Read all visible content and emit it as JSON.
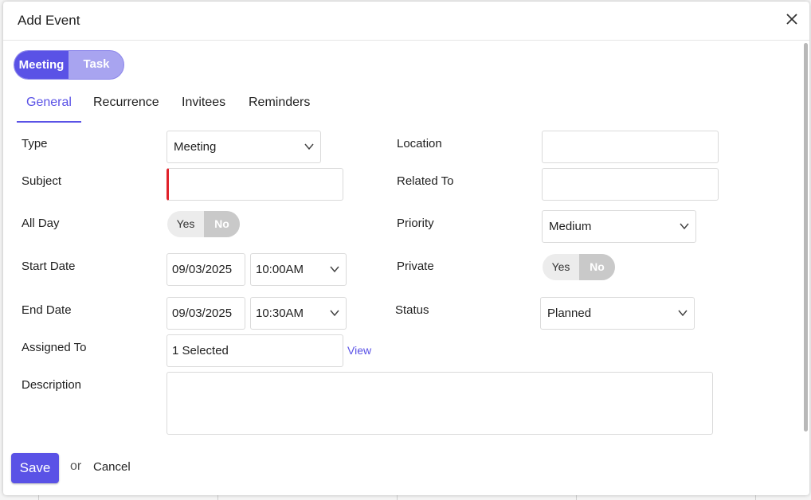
{
  "dialog": {
    "title": "Add Event"
  },
  "type_switch": {
    "active": "Meeting",
    "inactive": "Task"
  },
  "tabs": [
    {
      "label": "General"
    },
    {
      "label": "Recurrence"
    },
    {
      "label": "Invitees"
    },
    {
      "label": "Reminders"
    }
  ],
  "fields": {
    "type": {
      "label": "Type",
      "value": "Meeting"
    },
    "subject": {
      "label": "Subject",
      "value": ""
    },
    "all_day": {
      "label": "All Day",
      "yes": "Yes",
      "no": "No",
      "selected": "No"
    },
    "start_date": {
      "label": "Start Date",
      "date": "09/03/2025",
      "time": "10:00AM"
    },
    "end_date": {
      "label": "End Date",
      "date": "09/03/2025",
      "time": "10:30AM"
    },
    "assigned_to": {
      "label": "Assigned To",
      "value": "1 Selected",
      "link": "View"
    },
    "description": {
      "label": "Description",
      "value": ""
    },
    "location": {
      "label": "Location",
      "value": ""
    },
    "related_to": {
      "label": "Related To",
      "value": ""
    },
    "priority": {
      "label": "Priority",
      "value": "Medium"
    },
    "private": {
      "label": "Private",
      "yes": "Yes",
      "no": "No",
      "selected": "No"
    },
    "status": {
      "label": "Status",
      "value": "Planned"
    }
  },
  "footer": {
    "save": "Save",
    "or": "or",
    "cancel": "Cancel"
  },
  "colors": {
    "accent": "#5a52e6",
    "required": "#e0212a"
  },
  "icons": {
    "close": "close-icon",
    "chevron": "chevron-down-icon"
  }
}
